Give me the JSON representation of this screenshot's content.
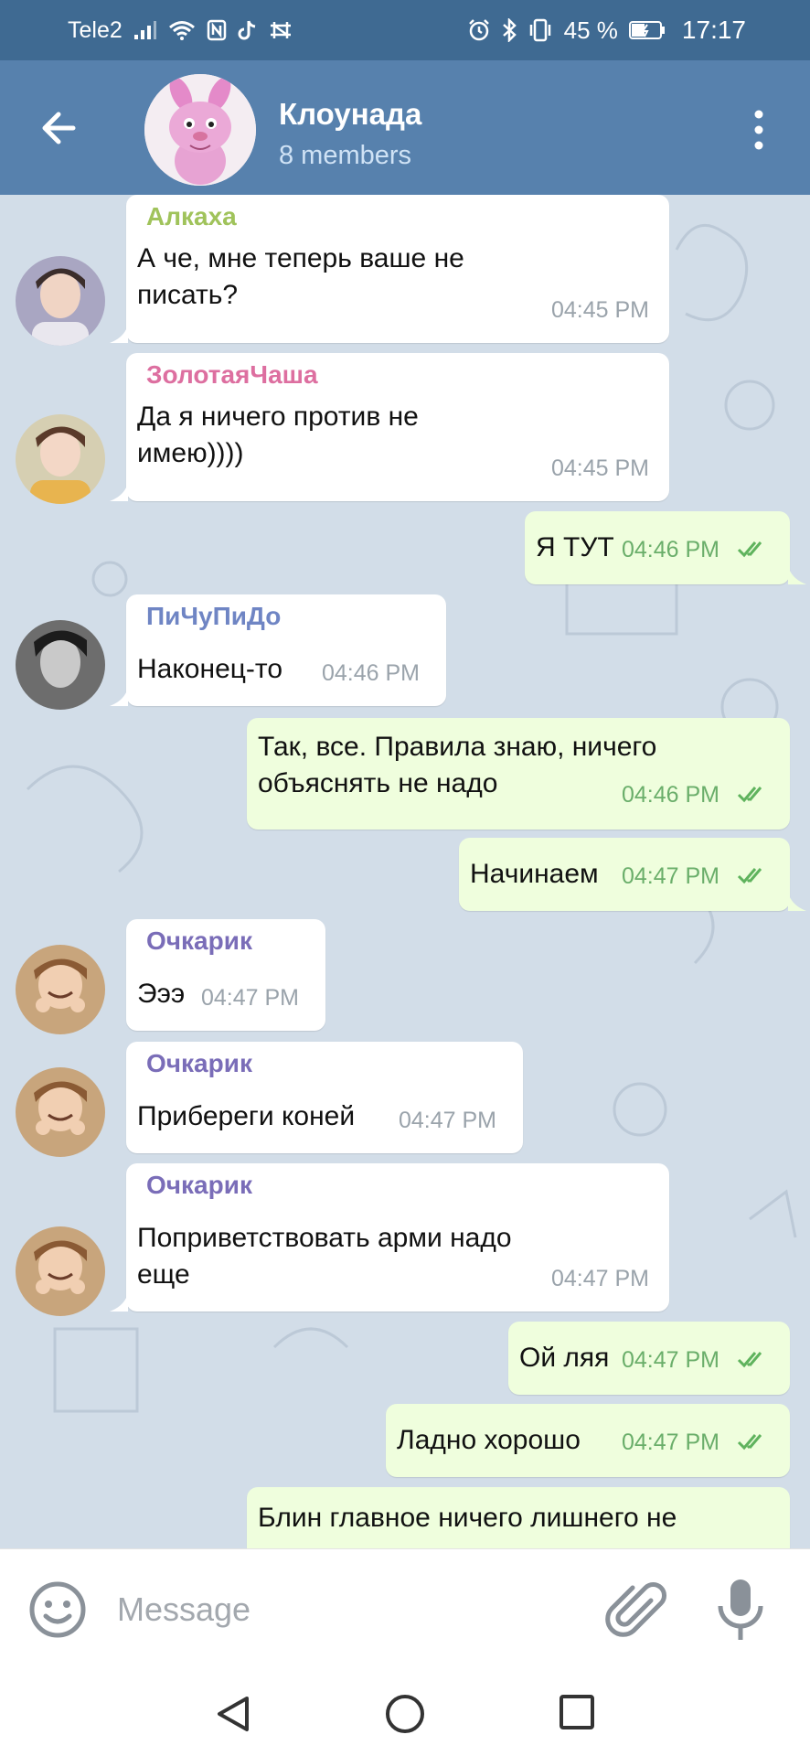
{
  "status_bar": {
    "carrier": "Tele2",
    "battery_percent": "45 %",
    "time": "17:17",
    "icons": [
      "signal-icon",
      "wifi-icon",
      "nfc-icon",
      "tiktok-icon",
      "vpn-icon",
      "alarm-icon",
      "bluetooth-icon",
      "vibrate-icon",
      "battery-icon"
    ]
  },
  "header": {
    "title": "Клоунада",
    "subtitle": "8 members",
    "back_icon": "arrow-left-icon",
    "menu_icon": "more-vert-icon"
  },
  "messages": [
    {
      "dir": "in",
      "sender": "Алкаха",
      "sender_color": "#a0c35b",
      "lines": [
        "А че, мне теперь ваше не",
        "писать?"
      ],
      "time": "04:45 PM"
    },
    {
      "dir": "in",
      "sender": "ЗолотаяЧаша",
      "sender_color": "#dd6fa0",
      "lines": [
        "Да я ничего против не",
        "имею))))"
      ],
      "time": "04:45 PM"
    },
    {
      "dir": "out",
      "lines": [
        "Я ТУТ"
      ],
      "time": "04:46 PM",
      "read": true
    },
    {
      "dir": "in",
      "sender": "ПиЧуПиДо",
      "sender_color": "#6f85c4",
      "lines": [
        "Наконец-то"
      ],
      "time": "04:46 PM"
    },
    {
      "dir": "out",
      "lines": [
        "Так, все. Правила знаю, ничего",
        "объяснять не надо"
      ],
      "time": "04:46 PM",
      "read": true
    },
    {
      "dir": "out",
      "lines": [
        "Начинаем"
      ],
      "time": "04:47 PM",
      "read": true
    },
    {
      "dir": "in",
      "sender": "Очкарик",
      "sender_color": "#7a6db8",
      "lines": [
        "Эээ"
      ],
      "time": "04:47 PM"
    },
    {
      "dir": "in",
      "sender": "Очкарик",
      "sender_color": "#7a6db8",
      "lines": [
        "Прибереги коней"
      ],
      "time": "04:47 PM"
    },
    {
      "dir": "in",
      "sender": "Очкарик",
      "sender_color": "#7a6db8",
      "lines": [
        "Поприветствовать арми надо",
        "еще"
      ],
      "time": "04:47 PM"
    },
    {
      "dir": "out",
      "lines": [
        "Ой ляя"
      ],
      "time": "04:47 PM",
      "read": true
    },
    {
      "dir": "out",
      "lines": [
        "Ладно хорошо"
      ],
      "time": "04:47 PM",
      "read": true
    },
    {
      "dir": "out",
      "lines": [
        "Блин главное ничего лишнего не"
      ],
      "time": "",
      "read": false
    }
  ],
  "input": {
    "placeholder": "Message",
    "emoji_icon": "emoji-icon",
    "attach_icon": "paperclip-icon",
    "mic_icon": "microphone-icon"
  },
  "nav": {
    "back_icon": "nav-back-icon",
    "home_icon": "nav-home-icon",
    "recent_icon": "nav-recent-icon"
  },
  "colors": {
    "status_bar_bg": "#3f6a92",
    "header_bg": "#5781ad",
    "incoming_bubble": "#ffffff",
    "outgoing_bubble": "#effedd",
    "chat_bg": "#d2dde8",
    "check_color": "#5fb35d"
  }
}
